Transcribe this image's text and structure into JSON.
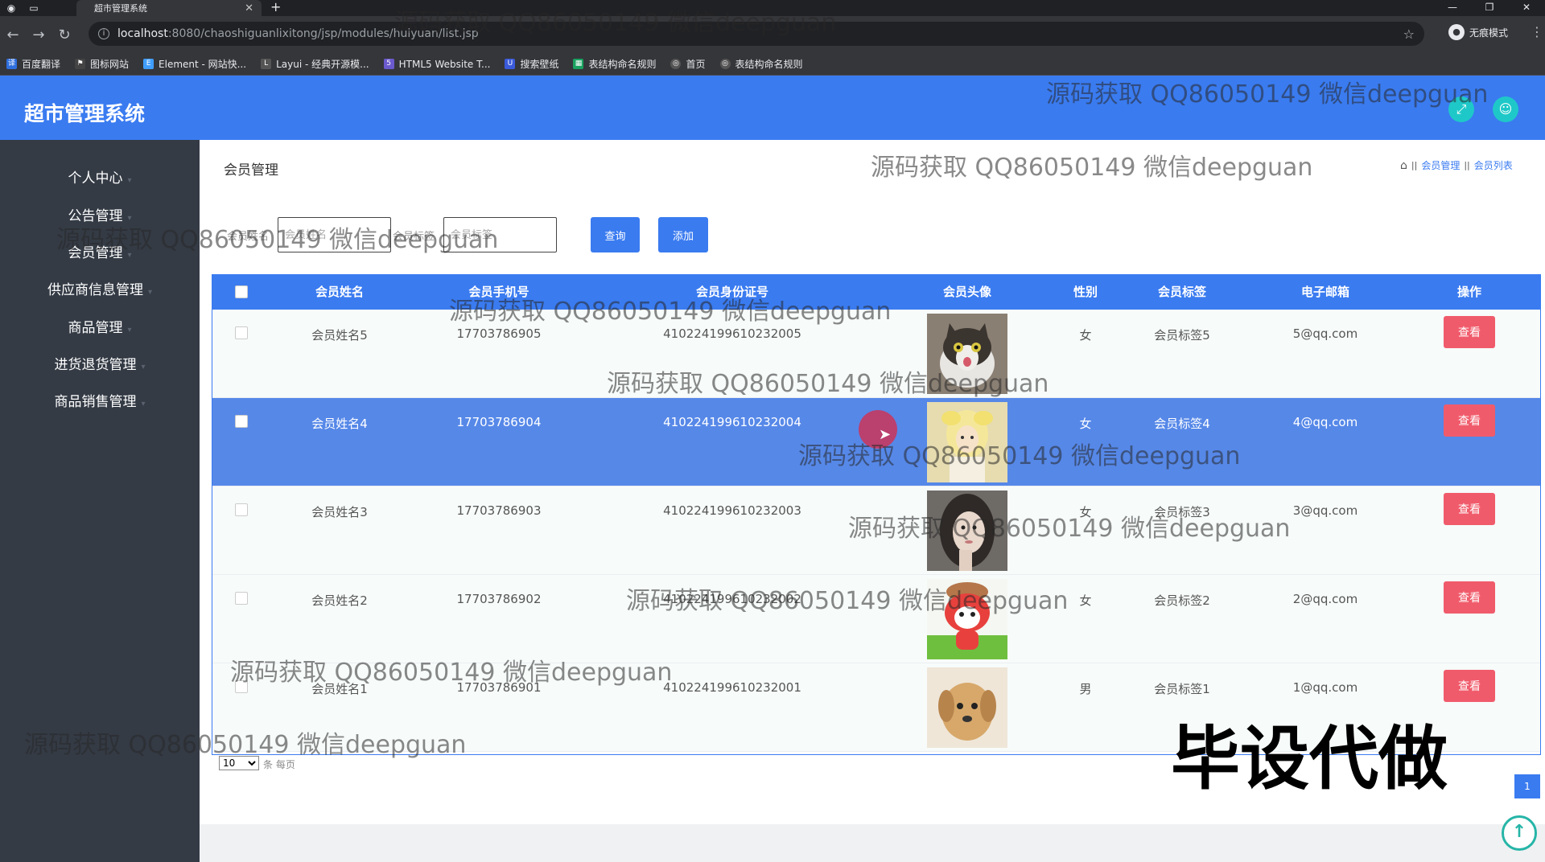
{
  "browser": {
    "tab_title": "超市管理系统",
    "url_host": "localhost",
    "url_path": ":8080/chaoshiguanlixitong/jsp/modules/huiyuan/list.jsp",
    "incognito_label": "无痕模式",
    "bookmarks": [
      "百度翻译",
      "图标网站",
      "Element - 网站快...",
      "Layui - 经典开源模...",
      "HTML5 Website T...",
      "搜索壁纸",
      "表结构命名规则",
      "首页",
      "表结构命名规则"
    ]
  },
  "app": {
    "title": "超市管理系统",
    "accent": "#3a7bf0"
  },
  "sidebar": {
    "items": [
      "个人中心",
      "公告管理",
      "会员管理",
      "供应商信息管理",
      "商品管理",
      "进货退货管理",
      "商品销售管理"
    ]
  },
  "page": {
    "title": "会员管理",
    "breadcrumbs": [
      "会员管理",
      "会员列表"
    ]
  },
  "search": {
    "label1": "会员姓名",
    "placeholder1": "会员姓名",
    "label2": "会员标签",
    "placeholder2": "会员标签",
    "query_btn": "查询",
    "add_btn": "添加"
  },
  "table": {
    "headers": [
      "会员姓名",
      "会员手机号",
      "会员身份证号",
      "会员头像",
      "性别",
      "会员标签",
      "电子邮箱",
      "操作"
    ],
    "rows": [
      {
        "name": "会员姓名5",
        "phone": "17703786905",
        "idcard": "410224199610232005",
        "avatar": "cat",
        "gender": "女",
        "tag": "会员标签5",
        "email": "5@qq.com",
        "action": "查看"
      },
      {
        "name": "会员姓名4",
        "phone": "17703786904",
        "idcard": "410224199610232004",
        "avatar": "flower-girl",
        "gender": "女",
        "tag": "会员标签4",
        "email": "4@qq.com",
        "action": "查看"
      },
      {
        "name": "会员姓名3",
        "phone": "17703786903",
        "idcard": "410224199610232003",
        "avatar": "girl-portrait",
        "gender": "女",
        "tag": "会员标签3",
        "email": "3@qq.com",
        "action": "查看"
      },
      {
        "name": "会员姓名2",
        "phone": "17703786902",
        "idcard": "410224199610232002",
        "avatar": "cartoon-fox",
        "gender": "女",
        "tag": "会员标签2",
        "email": "2@qq.com",
        "action": "查看"
      },
      {
        "name": "会员姓名1",
        "phone": "17703786901",
        "idcard": "410224199610232001",
        "avatar": "puppy",
        "gender": "男",
        "tag": "会员标签1",
        "email": "1@qq.com",
        "action": "查看"
      }
    ]
  },
  "pagination": {
    "page_size": "10",
    "per_page_label": "条 每页",
    "current_page": "1"
  },
  "overlay": {
    "watermark": "源码获取 QQ86050149 微信deepguan",
    "stamp": "毕设代做"
  }
}
